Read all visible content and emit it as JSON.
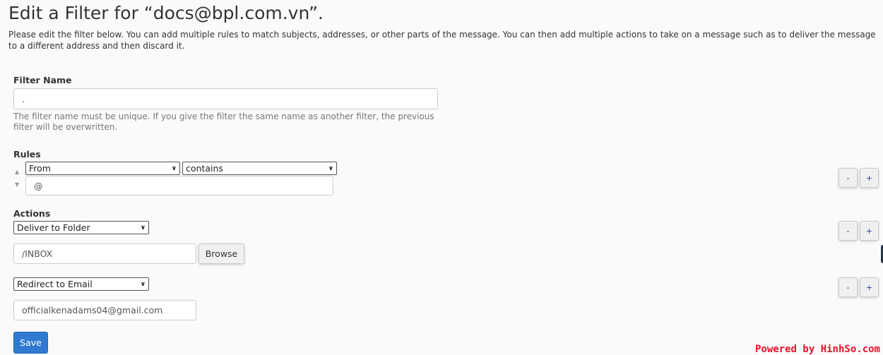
{
  "page": {
    "title": "Edit a Filter for “docs@bpl.com.vn”.",
    "description": "Please edit the filter below. You can add multiple rules to match subjects, addresses, or other parts of the message. You can then add multiple actions to take on a message such as to deliver the message to a different address and then discard it."
  },
  "filter_name": {
    "label": "Filter Name",
    "value": ".",
    "help": "The filter name must be unique. If you give the filter the same name as another filter, the previous filter will be overwritten."
  },
  "rules": {
    "label": "Rules",
    "items": [
      {
        "part": "From",
        "match": "contains",
        "value": "@"
      }
    ]
  },
  "actions": {
    "label": "Actions",
    "items": [
      {
        "action": "Deliver to Folder",
        "value": "/INBOX",
        "browse_label": "Browse"
      },
      {
        "action": "Redirect to Email",
        "value": "officialkenadams04@gmail.com"
      }
    ]
  },
  "buttons": {
    "minus": "-",
    "plus": "+",
    "save": "Save"
  },
  "watermark": "Powered by HinhSo.com"
}
